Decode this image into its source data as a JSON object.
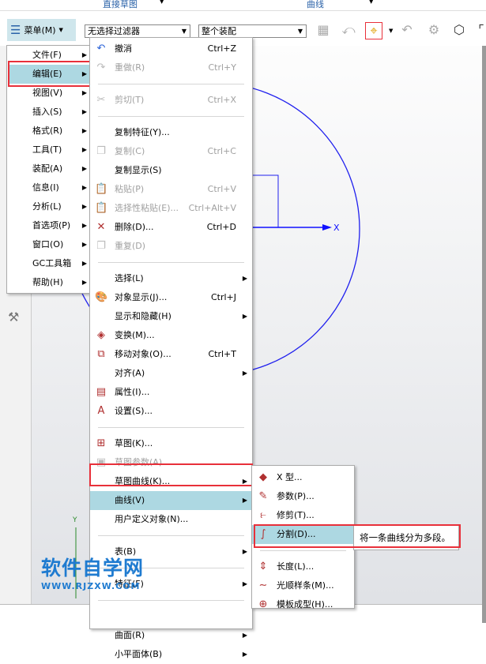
{
  "ribbon": {
    "tabs": [
      "直接草图",
      "曲线"
    ]
  },
  "toolbar": {
    "menu_label": "菜单(M)",
    "filter": "无选择过滤器",
    "scope": "整个装配"
  },
  "main_menu": [
    {
      "label": "文件(F)"
    },
    {
      "label": "编辑(E)",
      "selected": true
    },
    {
      "label": "视图(V)"
    },
    {
      "label": "插入(S)"
    },
    {
      "label": "格式(R)"
    },
    {
      "label": "工具(T)"
    },
    {
      "label": "装配(A)"
    },
    {
      "label": "信息(I)"
    },
    {
      "label": "分析(L)"
    },
    {
      "label": "首选项(P)"
    },
    {
      "label": "窗口(O)"
    },
    {
      "label": "GC工具箱"
    },
    {
      "label": "帮助(H)"
    }
  ],
  "edit_menu": [
    {
      "label": "撤消",
      "shortcut": "Ctrl+Z",
      "icon": "undo-icon"
    },
    {
      "label": "重做(R)",
      "shortcut": "Ctrl+Y",
      "icon": "redo-icon",
      "disabled": true
    },
    {
      "sep": true
    },
    {
      "label": "剪切(T)",
      "shortcut": "Ctrl+X",
      "icon": "scissors-icon",
      "disabled": true
    },
    {
      "sep": true
    },
    {
      "label": "复制特征(Y)..."
    },
    {
      "label": "复制(C)",
      "shortcut": "Ctrl+C",
      "icon": "copy-icon",
      "disabled": true
    },
    {
      "label": "复制显示(S)"
    },
    {
      "label": "粘贴(P)",
      "shortcut": "Ctrl+V",
      "icon": "paste-icon",
      "disabled": true
    },
    {
      "label": "选择性粘贴(E)...",
      "shortcut": "Ctrl+Alt+V",
      "icon": "paste-special-icon",
      "disabled": true
    },
    {
      "label": "删除(D)...",
      "shortcut": "Ctrl+D",
      "icon": "delete-icon"
    },
    {
      "label": "重复(D)",
      "icon": "repeat-icon",
      "disabled": true
    },
    {
      "sep": true
    },
    {
      "label": "选择(L)",
      "sub": true
    },
    {
      "label": "对象显示(J)...",
      "shortcut": "Ctrl+J",
      "icon": "object-display-icon"
    },
    {
      "label": "显示和隐藏(H)",
      "sub": true
    },
    {
      "label": "变换(M)...",
      "icon": "transform-icon"
    },
    {
      "label": "移动对象(O)...",
      "shortcut": "Ctrl+T",
      "icon": "move-object-icon"
    },
    {
      "label": "对齐(A)",
      "sub": true
    },
    {
      "label": "属性(I)...",
      "icon": "properties-icon"
    },
    {
      "label": "设置(S)...",
      "icon": "settings-icon"
    },
    {
      "sep": true
    },
    {
      "label": "草图(K)...",
      "icon": "sketch-icon"
    },
    {
      "label": "草图参数(A)...",
      "icon": "sketch-params-icon",
      "disabled": true
    },
    {
      "label": "草图曲线(K)...",
      "sub": true
    },
    {
      "label": "曲线(V)",
      "sub": true,
      "selected": true
    },
    {
      "label": "用户定义对象(N)..."
    },
    {
      "sep": true
    },
    {
      "label": "表(B)",
      "sub": true
    },
    {
      "sep": true
    },
    {
      "label": "特征(F)",
      "sub": true
    },
    {
      "sep": true
    },
    {
      "label": "",
      "blank": true
    },
    {
      "label": "曲面(R)",
      "sub": true
    },
    {
      "label": "小平面体(B)",
      "sub": true
    }
  ],
  "curve_menu": [
    {
      "label": "X 型...",
      "icon": "x-form-icon"
    },
    {
      "label": "参数(P)...",
      "icon": "parameters-icon"
    },
    {
      "label": "修剪(T)...",
      "icon": "trim-icon"
    },
    {
      "label": "分割(D)...",
      "icon": "divide-curve-icon",
      "selected": true
    },
    {
      "sep": true
    },
    {
      "label": "长度(L)...",
      "icon": "length-icon"
    },
    {
      "label": "光顺样条(M)...",
      "icon": "smooth-spline-icon"
    },
    {
      "label": "模板成型(H)...",
      "icon": "template-shape-icon"
    }
  ],
  "tooltip": "将一条曲线分为多段。",
  "canvas": {
    "axis_x": "X",
    "axis_y": "Y"
  },
  "watermark": {
    "title": "软件自学网",
    "url": "WWW.RJZXW.COM"
  },
  "colors": {
    "highlight": "#add8e2",
    "callout": "#e8303a",
    "curve": "#1a1aff"
  }
}
